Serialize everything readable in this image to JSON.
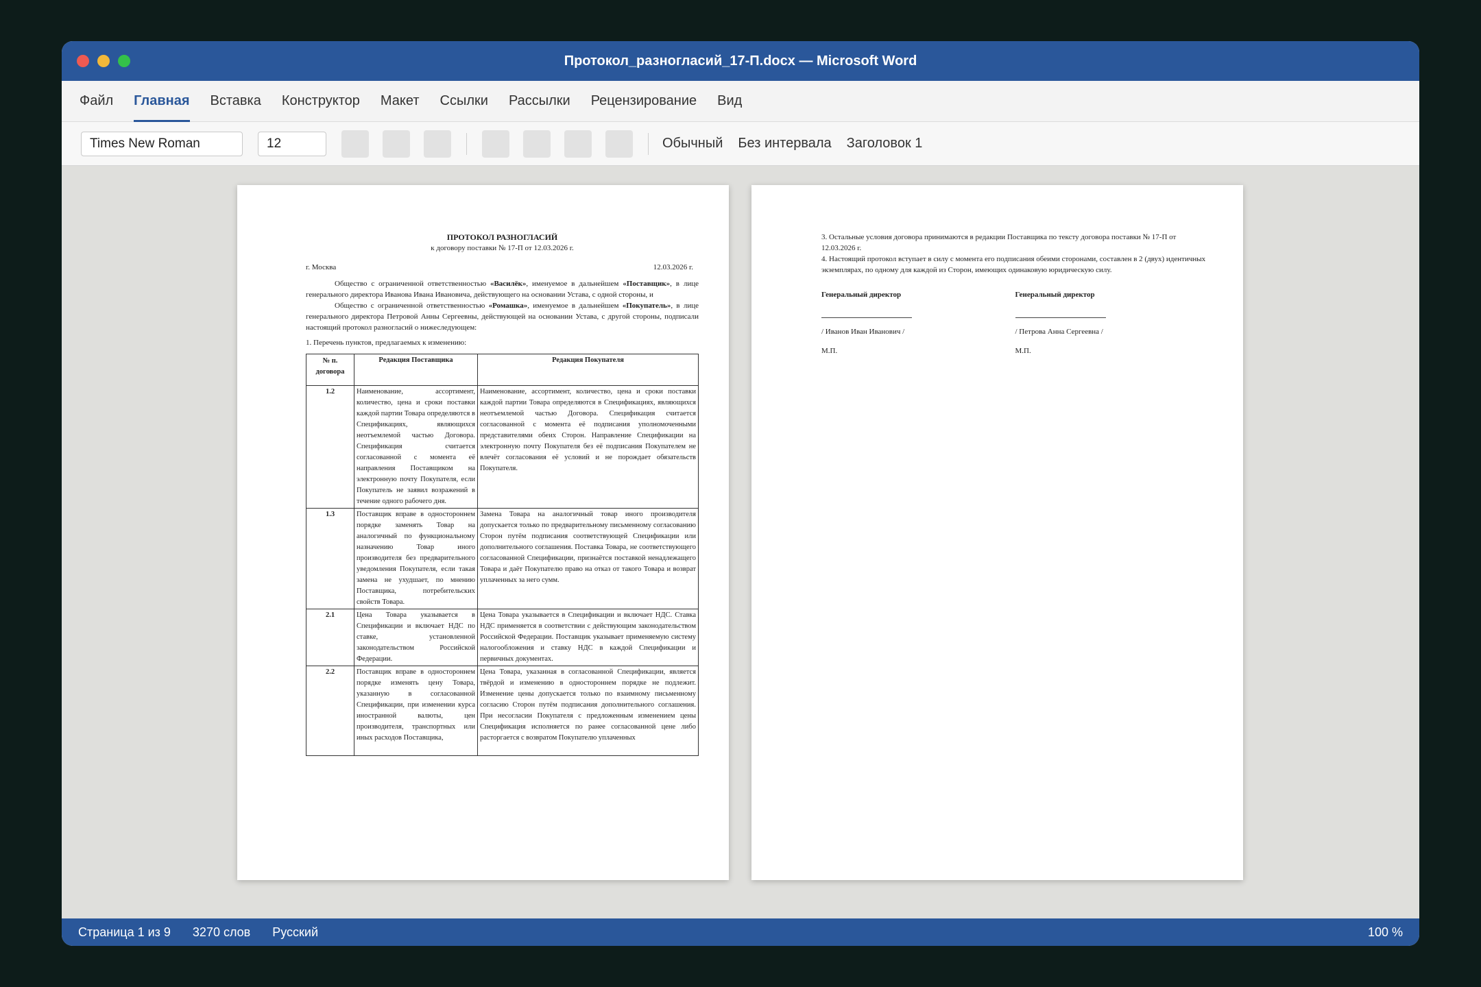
{
  "window": {
    "title": "Протокол_разногласий_17-П.docx — Microsoft Word"
  },
  "tabs": [
    "Файл",
    "Главная",
    "Вставка",
    "Конструктор",
    "Макет",
    "Ссылки",
    "Рассылки",
    "Рецензирование",
    "Вид"
  ],
  "active_tab": "Главная",
  "toolbar": {
    "font": "Times New Roman",
    "size": "12",
    "styles": [
      "Обычный",
      "Без интервала",
      "Заголовок 1"
    ]
  },
  "doc": {
    "title": "ПРОТОКОЛ РАЗНОГЛАСИЙ",
    "subtitle": "к договору поставки № 17-П от 12.03.2026 г.",
    "city": "г. Москва",
    "date": "12.03.2026 г.",
    "para1": {
      "a": "Общество с ограниченной ответственностью ",
      "b": "«Василёк»",
      "c": ", именуемое в дальнейшем ",
      "d": "«Поставщик»",
      "e": ", в лице генерального директора Иванова Ивана Ивановича, действующего на основании Устава, с одной стороны, и"
    },
    "para2": {
      "a": "Общество с ограниченной ответственностью ",
      "b": "«Ромашка»",
      "c": ", именуемое в дальнейшем ",
      "d": "«Покупатель»",
      "e": ", в лице генерального директора Петровой Анны Сергеевны, действующей на основании Устава, с другой стороны, подписали настоящий протокол разногласий о нижеследующем:"
    },
    "item1": "1. Перечень пунктов, предлагаемых к изменению:",
    "table": {
      "headers": [
        "№ п. договора",
        "Редакция Поставщика",
        "Редакция Покупателя"
      ],
      "rows": [
        {
          "num": "1.2",
          "supplier": "Наименование, ассортимент, количество, цена и сроки поставки каждой партии Товара определяются в Спецификациях, являющихся неотъемлемой частью Договора. Спецификация считается согласованной с момента её направления Поставщиком на электронную почту Покупателя, если Покупатель не заявил возражений в течение одного рабочего дня.",
          "buyer": "Наименование, ассортимент, количество, цена и сроки поставки каждой партии Товара определяются в Спецификациях, являющихся неотъемлемой частью Договора. Спецификация считается согласованной с момента её подписания уполномоченными представителями обеих Сторон. Направление Спецификации на электронную почту Покупателя без её подписания Покупателем не влечёт согласования её условий и не порождает обязательств Покупателя."
        },
        {
          "num": "1.3",
          "supplier": "Поставщик вправе в одностороннем порядке заменять Товар на аналогичный по функциональному назначению Товар иного производителя без предварительного уведомления Покупателя, если такая замена не ухудшает, по мнению Поставщика, потребительских свойств Товара.",
          "buyer": "Замена Товара на аналогичный товар иного производителя допускается только по предварительному письменному согласованию Сторон путём подписания соответствующей Спецификации или дополнительного соглашения. Поставка Товара, не соответствующего согласованной Спецификации, признаётся поставкой ненадлежащего Товара и даёт Покупателю право на отказ от такого Товара и возврат уплаченных за него сумм."
        },
        {
          "num": "2.1",
          "supplier": "Цена Товара указывается в Спецификации и включает НДС по ставке, установленной законодательством Российской Федерации.",
          "buyer": "Цена Товара указывается в Спецификации и включает НДС. Ставка НДС применяется в соответствии с действующим законодательством Российской Федерации. Поставщик указывает применяемую систему налогообложения и ставку НДС в каждой Спецификации и первичных документах."
        },
        {
          "num": "2.2",
          "supplier": "Поставщик вправе в одностороннем порядке изменять цену Товара, указанную в согласованной Спецификации, при изменении курса иностранной валюты, цен производителя, транспортных или иных расходов Поставщика,",
          "buyer": "Цена Товара, указанная в согласованной Спецификации, является твёрдой и изменению в одностороннем порядке не подлежит. Изменение цены допускается только по взаимному письменному согласию Сторон путём подписания дополнительного соглашения. При несогласии Покупателя с предложенным изменением цены Спецификация исполняется по ранее согласованной цене либо расторгается с возвратом Покупателю уплаченных"
        }
      ]
    },
    "page2": {
      "item3": "3. Остальные условия договора принимаются в редакции Поставщика по тексту договора поставки № 17-П от 12.03.2026 г.",
      "item4": "4. Настоящий протокол вступает в силу с момента его подписания обеими сторонами, составлен в 2 (двух) идентичных экземплярах, по одному для каждой из Сторон, имеющих одинаковую юридическую силу.",
      "signatures": [
        {
          "title": "Генеральный директор",
          "name": "/ Иванов Иван Иванович /",
          "stamp": "М.П."
        },
        {
          "title": "Генеральный директор",
          "name": "/ Петрова Анна Сергеевна /",
          "stamp": "М.П."
        }
      ]
    }
  },
  "status": {
    "page": "Страница 1 из 9",
    "words": "3270 слов",
    "language": "Русский",
    "zoom": "100 %"
  },
  "colors": {
    "accent": "#2a579a",
    "background": "#0d1c1a",
    "canvas": "#dfdfdc"
  }
}
